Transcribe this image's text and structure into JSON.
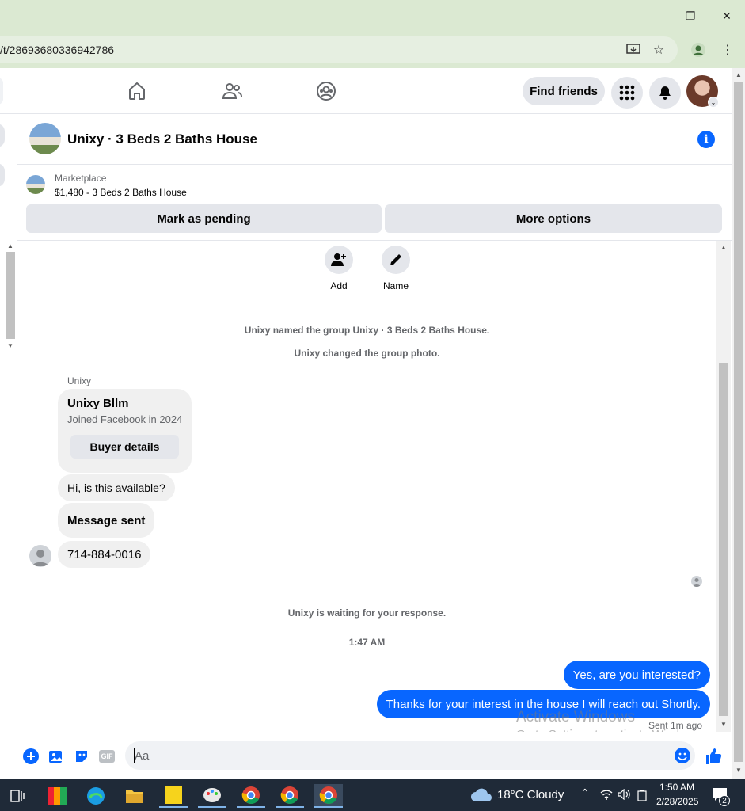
{
  "browser": {
    "url": "/t/28693680336942786",
    "window_controls": {
      "minimize": "—",
      "restore": "❐",
      "close": "✕"
    }
  },
  "header": {
    "find_friends": "Find friends"
  },
  "conversation": {
    "title": "Unixy · 3 Beds 2 Baths House",
    "marketplace_label": "Marketplace",
    "listing": "$1,480 - 3 Beds 2 Baths House",
    "mark_pending": "Mark as pending",
    "more_options": "More options"
  },
  "actions": {
    "add": "Add",
    "name": "Name"
  },
  "messages": {
    "sys_named": "Unixy named the group Unixy · 3 Beds 2 Baths House.",
    "sys_photo": "Unixy changed the group photo.",
    "sender": "Unixy",
    "card_title": "Unixy Bllm",
    "card_sub": "Joined Facebook in 2024",
    "card_button": "Buyer details",
    "in1": "Hi, is this available?",
    "in2": "Message sent",
    "in3": "714-884-0016",
    "waiting": "Unixy is waiting for your response.",
    "time": "1:47 AM",
    "out1": "Yes, are you interested?",
    "out2": "Thanks for your interest in the house I will reach out Shortly.",
    "status": "Sent 1m ago"
  },
  "composer": {
    "placeholder": "Aa",
    "gif": "GIF"
  },
  "watermark": {
    "line1": "Activate Windows",
    "line2": "Go to Settings to activate Windows."
  },
  "taskbar": {
    "weather": "18°C  Cloudy",
    "time": "1:50 AM",
    "date": "2/28/2025",
    "notifications": "2"
  }
}
